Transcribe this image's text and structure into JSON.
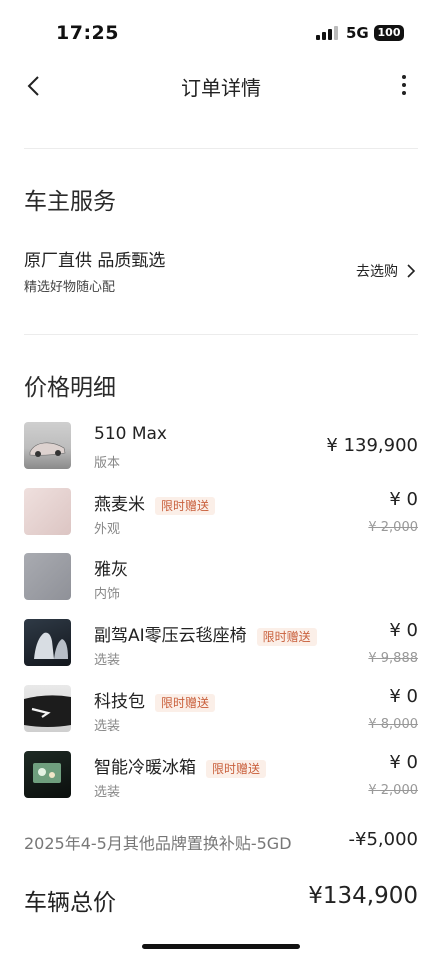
{
  "status_bar": {
    "time": "17:25",
    "network": "5G",
    "battery": "100"
  },
  "nav": {
    "title": "订单详情"
  },
  "owner_service": {
    "heading": "车主服务",
    "title": "原厂直供 品质甄选",
    "subtitle": "精选好物随心配",
    "link": "去选购"
  },
  "price_detail": {
    "heading": "价格明细",
    "items": [
      {
        "name": "510 Max",
        "sub": "版本",
        "price": "¥ 139,900",
        "tag": "",
        "original": ""
      },
      {
        "name": "燕麦米",
        "sub": "外观",
        "price": "¥ 0",
        "tag": "限时赠送",
        "original": "¥ 2,000"
      },
      {
        "name": "雅灰",
        "sub": "内饰",
        "price": "",
        "tag": "",
        "original": ""
      },
      {
        "name": "副驾AI零压云毯座椅",
        "sub": "选装",
        "price": "¥ 0",
        "tag": "限时赠送",
        "original": "¥ 9,888"
      },
      {
        "name": "科技包",
        "sub": "选装",
        "price": "¥ 0",
        "tag": "限时赠送",
        "original": "¥ 8,000"
      },
      {
        "name": "智能冷暖冰箱",
        "sub": "选装",
        "price": "¥ 0",
        "tag": "限时赠送",
        "original": "¥ 2,000"
      }
    ],
    "subsidy_label": "2025年4-5月其他品牌置换补贴-5GD",
    "subsidy_value": "-¥5,000",
    "total_label": "车辆总价",
    "total_value": "¥134,900"
  },
  "colors": {
    "tag_text": "#c9603c",
    "tag_bg": "#fbefe8",
    "oat_swatch": "#e8d4d2",
    "gray_swatch": "#9ea0a7"
  }
}
